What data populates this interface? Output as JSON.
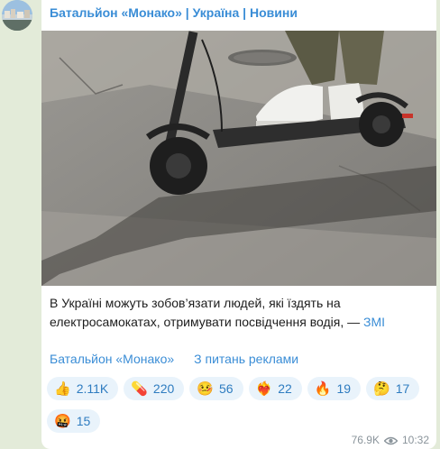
{
  "channel": {
    "title": "Батальйон «Монако» | Україна | Новини"
  },
  "message": {
    "text": "В Україні можуть зобов’язати людей, які їздять на електросамокатах, отримувати посвідчення водія, — ",
    "source": "ЗМІ"
  },
  "links": [
    {
      "label": "Батальйон «Монако»"
    },
    {
      "label": "З питань реклами"
    }
  ],
  "reactions": [
    {
      "emoji": "👍",
      "count": "2.11K"
    },
    {
      "emoji": "💊",
      "count": "220"
    },
    {
      "emoji": "🤒",
      "count": "56"
    },
    {
      "emoji": "❤️‍🔥",
      "count": "22"
    },
    {
      "emoji": "🔥",
      "count": "19"
    },
    {
      "emoji": "🤔",
      "count": "17"
    },
    {
      "emoji": "🤬",
      "count": "15"
    }
  ],
  "meta": {
    "views": "76.9K",
    "time": "10:32"
  },
  "colors": {
    "accent": "#3a8dd6",
    "reaction_bg": "#e9f3fb",
    "chat_bg": "#e3ebd9"
  }
}
